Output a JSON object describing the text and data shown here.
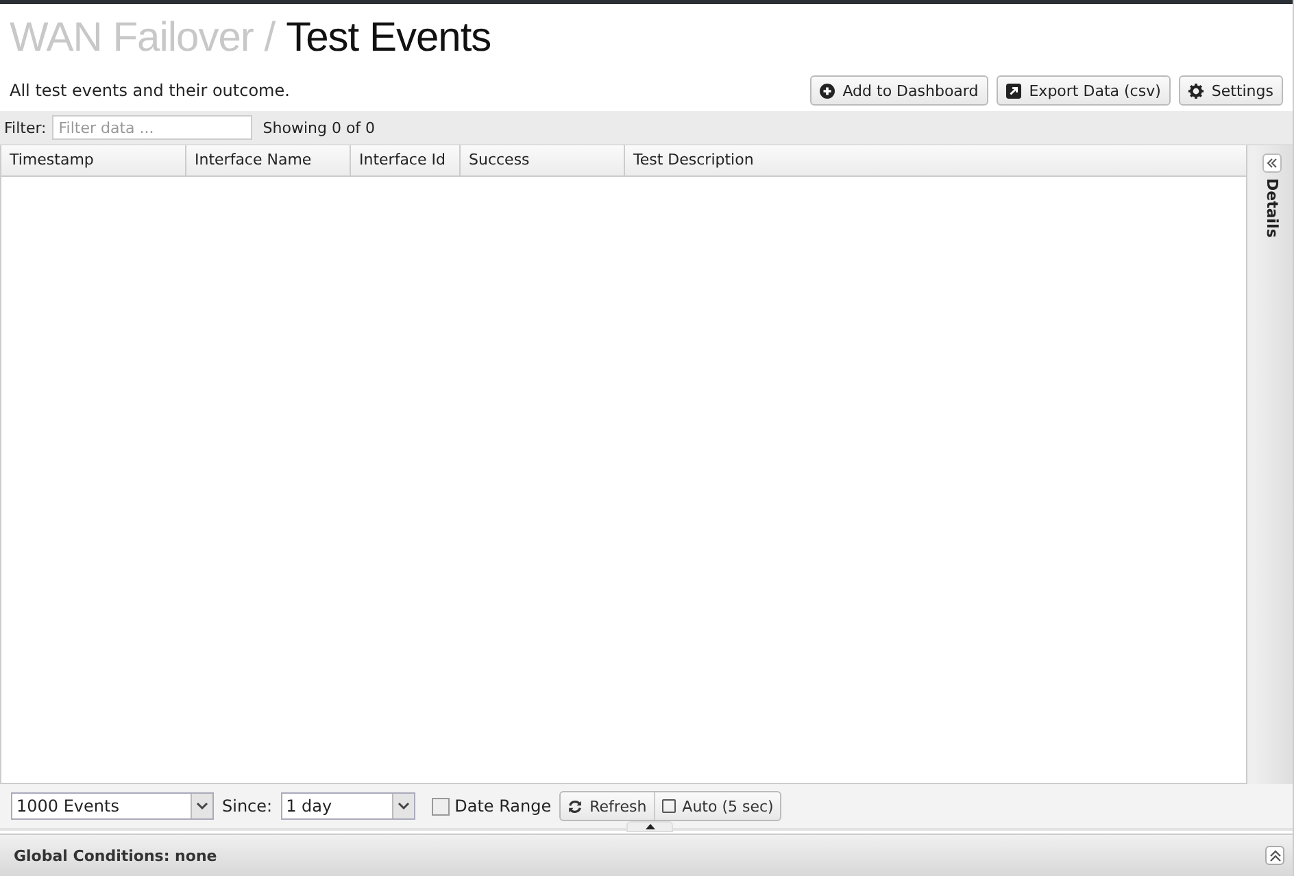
{
  "header": {
    "breadcrumb": "WAN Failover /",
    "title": "Test Events",
    "description": "All test events and their outcome.",
    "buttons": [
      {
        "kind": "dashboard",
        "label": "Add to Dashboard"
      },
      {
        "kind": "export",
        "label": "Export Data (csv)"
      },
      {
        "kind": "settings",
        "label": "Settings"
      }
    ]
  },
  "filter": {
    "label": "Filter:",
    "placeholder": "Filter data ...",
    "count": "Showing 0 of 0"
  },
  "table": {
    "columns": [
      {
        "label": "Timestamp"
      },
      {
        "label": "Interface Name"
      },
      {
        "label": "Interface Id"
      },
      {
        "label": "Success"
      },
      {
        "label": "Test Description"
      }
    ]
  },
  "details": {
    "label": "Details"
  },
  "toolbar": {
    "limit": "1000 Events",
    "since_label": "Since:",
    "since": "1 day",
    "date_range": {
      "label": "Date Range",
      "checked": false
    },
    "refresh": "Refresh",
    "auto": {
      "label": "Auto (5 sec)",
      "checked": false
    }
  },
  "global_conditions": "Global Conditions: none"
}
